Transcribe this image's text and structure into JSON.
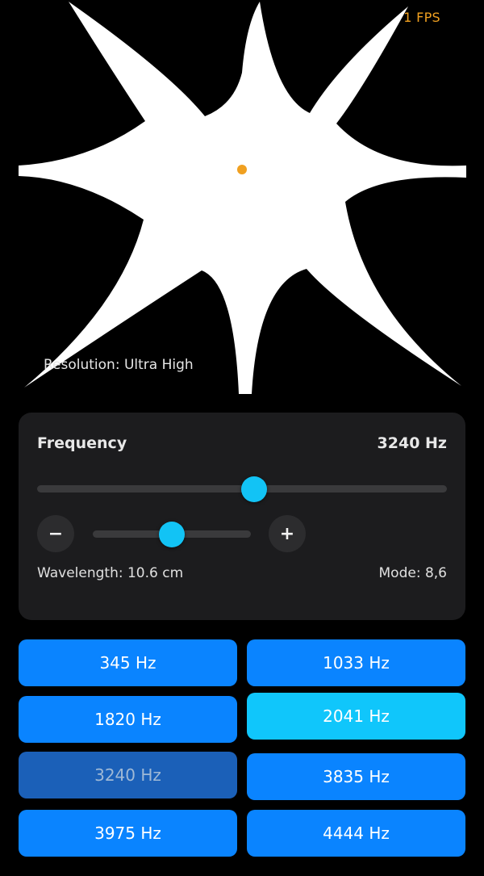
{
  "visual": {
    "fps": "1 FPS",
    "resolution": "Resolution: Ultra High",
    "pattern_color": "#ffffff",
    "center_dot_color": "#f0a020",
    "pattern_arms": 8
  },
  "panel": {
    "title": "Frequency",
    "value": "3240 Hz",
    "slider_fraction": 0.53,
    "fine_fraction": 0.5,
    "minus_label": "−",
    "plus_label": "+",
    "wavelength": "Wavelength: 10.6 cm",
    "mode": "Mode: 8,6"
  },
  "presets": [
    {
      "label": "345 Hz",
      "state": "normal"
    },
    {
      "label": "1033 Hz",
      "state": "normal"
    },
    {
      "label": "1820 Hz",
      "state": "normal"
    },
    {
      "label": "2041 Hz",
      "state": "active"
    },
    {
      "label": "3240 Hz",
      "state": "current"
    },
    {
      "label": "3835 Hz",
      "state": "normal"
    },
    {
      "label": "3975 Hz",
      "state": "normal"
    },
    {
      "label": "4444 Hz",
      "state": "normal"
    }
  ],
  "colors": {
    "accent": "#0a84ff",
    "thumb": "#12c3f5",
    "panel": "#1c1c1e"
  }
}
